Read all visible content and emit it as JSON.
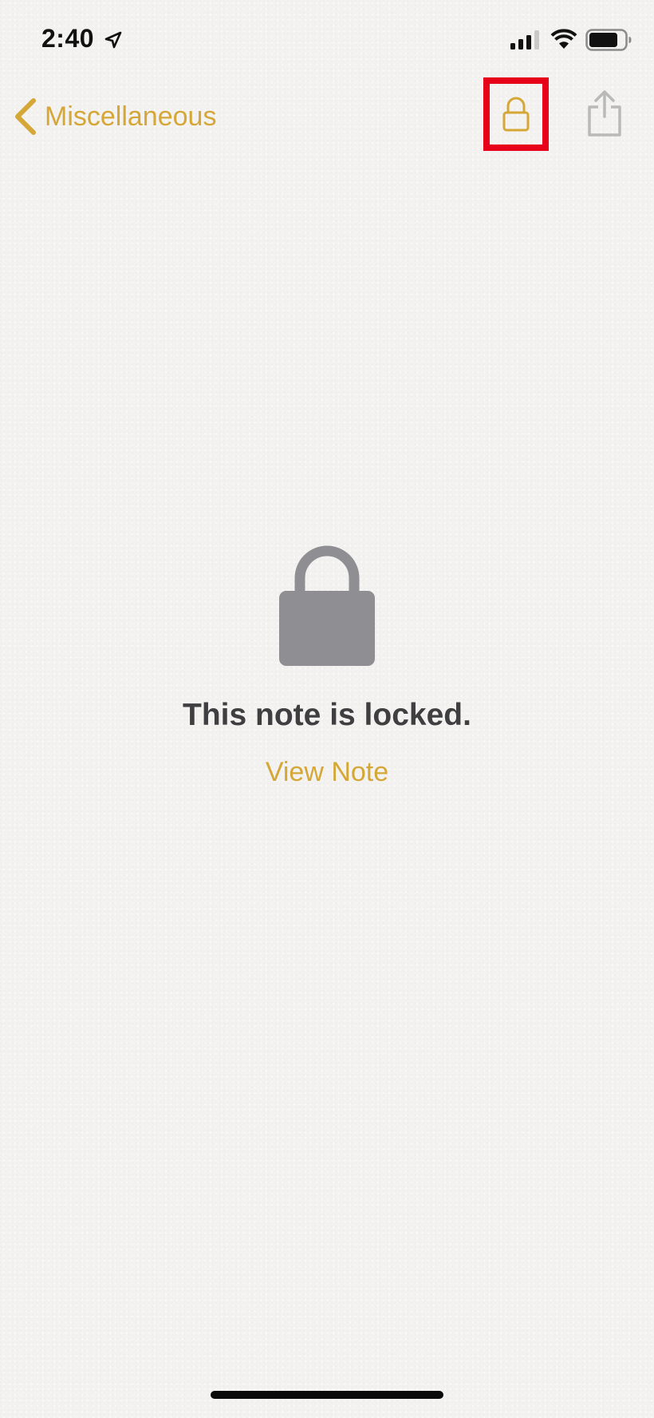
{
  "status_bar": {
    "time": "2:40",
    "icons": [
      "location-arrow-icon",
      "cellular-signal-icon",
      "wifi-icon",
      "battery-icon"
    ]
  },
  "nav": {
    "back_label": "Miscellaneous",
    "lock_button_icon": "lock-open-icon",
    "share_button_icon": "share-icon"
  },
  "locked": {
    "icon": "lock-icon",
    "message": "This note is locked.",
    "action": "View Note"
  },
  "colors": {
    "accent": "#d4a737",
    "highlight": "#e8001a",
    "lock_gray": "#8e8e93",
    "message_text": "#3f3f42",
    "background": "#f3f2f0"
  }
}
